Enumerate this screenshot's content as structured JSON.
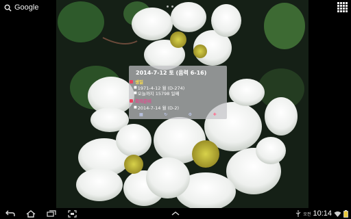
{
  "top_bar": {
    "search_label": "Google",
    "search_icon": "search-icon",
    "apps_icon": "apps-grid-icon"
  },
  "widget": {
    "date_line": "2014-7-12 토 (음력 6-16)",
    "sections": [
      {
        "title": "생일",
        "items": [
          "1971-4-12 월 (D-274)",
          "오늘까지 15798 일째"
        ]
      },
      {
        "title": "회의준비",
        "items": [
          "2014-7-14 월 (D-2)"
        ]
      }
    ],
    "toolbar_icons": [
      "calendar-icon",
      "refresh-icon",
      "settings-icon",
      "add-icon"
    ]
  },
  "navbar": {
    "back_icon": "back-icon",
    "home_icon": "home-icon",
    "recent_icon": "recent-apps-icon",
    "screenshot_icon": "screenshot-icon",
    "up_icon": "chevron-up-icon",
    "carrier": "오전",
    "time": "10:14",
    "status_icons": [
      "usb-icon",
      "wifi-icon",
      "battery-icon"
    ]
  },
  "colors": {
    "accent_yellow": "#ffe04a",
    "accent_pink": "#e44b8e",
    "marker_red": "#e9435f"
  }
}
